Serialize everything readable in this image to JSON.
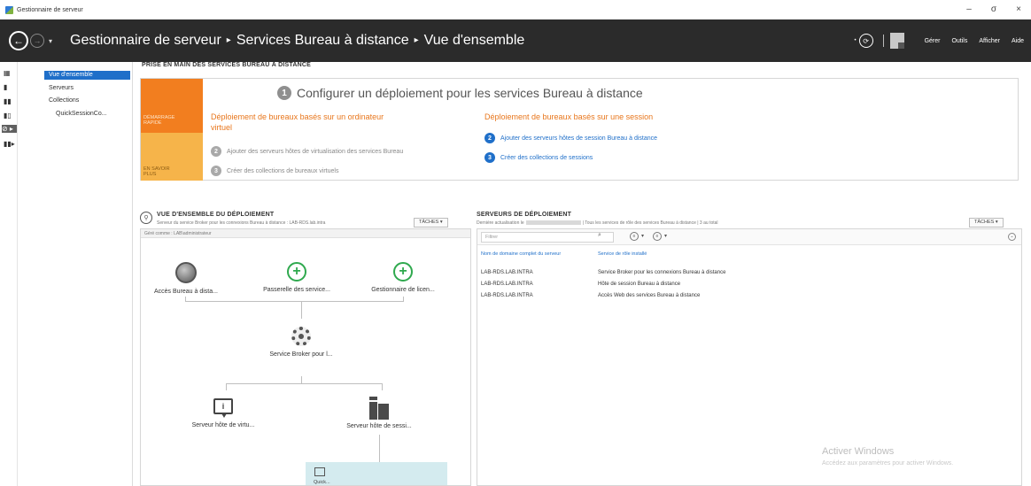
{
  "titlebar": {
    "app_title": "Gestionnaire de serveur",
    "minimize": "–",
    "maximize": "σ",
    "close": "×"
  },
  "header": {
    "crumbs": [
      "Gestionnaire de serveur",
      "Services Bureau à distance",
      "Vue d'ensemble"
    ],
    "separator": "▸",
    "menus": {
      "manage": "Gérer",
      "tools": "Outils",
      "view": "Afficher",
      "help": "Aide"
    }
  },
  "nav": {
    "items": [
      "Vue d'ensemble",
      "Serveurs",
      "Collections",
      "QuickSessionCo..."
    ]
  },
  "quick_start": {
    "title": "PRISE EN MAIN DES SERVICES BUREAU À DISTANCE",
    "quick_start_tab": [
      "DÉMARRAGE",
      "RAPIDE"
    ],
    "learn_more_tab": [
      "EN SAVOIR",
      "PLUS"
    ],
    "step1": {
      "num": "1",
      "text": "Configurer un déploiement pour les services Bureau à distance"
    },
    "left": {
      "heading_line1": "Déploiement de bureaux basés sur un ordinateur",
      "heading_line2": "virtuel",
      "steps": [
        {
          "num": "2",
          "text": "Ajouter des serveurs hôtes de virtualisation des services Bureau"
        },
        {
          "num": "3",
          "text": "Créer des collections de bureaux virtuels"
        }
      ]
    },
    "right": {
      "heading": "Déploiement de bureaux basés sur une session",
      "steps": [
        {
          "num": "2",
          "text": "Ajouter des serveurs hôtes de session Bureau à distance"
        },
        {
          "num": "3",
          "text": "Créer des collections de sessions"
        }
      ]
    }
  },
  "deployment_overview": {
    "title": "VUE D'ENSEMBLE DU DÉPLOIEMENT",
    "subtitle": "Serveur du service Broker pour les connexions Bureau à distance : LAB-RDS.lab.intra",
    "tasks": "TÂCHES ▾",
    "managed_as": "Géré comme : LAB\\administrateur",
    "nodes": {
      "rdweb": "Accès Bureau à dista...",
      "gateway": "Passerelle des service...",
      "licensing": "Gestionnaire de licen...",
      "broker": "Service Broker pour l...",
      "virt_host": "Serveur hôte de virtu...",
      "session_host": "Serveur hôte de sessi...",
      "collection": "Quick..."
    }
  },
  "deployment_servers": {
    "title": "SERVEURS DE DÉPLOIEMENT",
    "last_refresh_prefix": "Dernière actualisation le",
    "last_refresh_suffix": "| Tous les services de rôle des services Bureau à distance | 3 au total",
    "tasks": "TÂCHES ▾",
    "filter_placeholder": "Filtrer",
    "columns": [
      "Nom de domaine complet du serveur",
      "Service de rôle installé"
    ],
    "rows": [
      [
        "LAB-RDS.LAB.INTRA",
        "Service Broker pour les connexions Bureau à distance"
      ],
      [
        "LAB-RDS.LAB.INTRA",
        "Hôte de session Bureau à distance"
      ],
      [
        "LAB-RDS.LAB.INTRA",
        "Accès Web des services Bureau à distance"
      ]
    ]
  },
  "watermark": {
    "title": "Activer Windows",
    "subtitle": "Accédez aux paramètres pour activer Windows."
  },
  "colors": {
    "accent": "#1f6fc9",
    "orange": "#f27e1f",
    "orange_light": "#f6b44a",
    "header_bg": "#2b2b2b",
    "green": "#2fa94e",
    "selection_tint": "#d4ebef"
  },
  "icons": {
    "back": "back-arrow-icon",
    "forward": "forward-arrow-icon",
    "refresh": "refresh-icon",
    "notifications": "flag-icon",
    "search": "search-icon",
    "globe": "globe-icon",
    "add": "plus-icon",
    "broker": "gear-icon",
    "info": "info-icon",
    "server": "server-icon"
  }
}
